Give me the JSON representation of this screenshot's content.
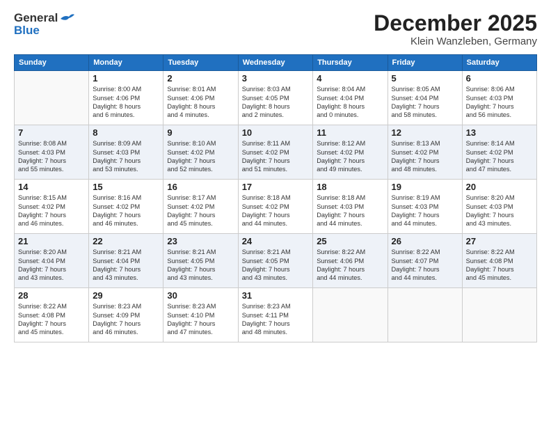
{
  "header": {
    "logo_general": "General",
    "logo_blue": "Blue",
    "title": "December 2025",
    "subtitle": "Klein Wanzleben, Germany"
  },
  "days": [
    "Sunday",
    "Monday",
    "Tuesday",
    "Wednesday",
    "Thursday",
    "Friday",
    "Saturday"
  ],
  "weeks": [
    [
      {
        "date": "",
        "info": ""
      },
      {
        "date": "1",
        "info": "Sunrise: 8:00 AM\nSunset: 4:06 PM\nDaylight: 8 hours\nand 6 minutes."
      },
      {
        "date": "2",
        "info": "Sunrise: 8:01 AM\nSunset: 4:06 PM\nDaylight: 8 hours\nand 4 minutes."
      },
      {
        "date": "3",
        "info": "Sunrise: 8:03 AM\nSunset: 4:05 PM\nDaylight: 8 hours\nand 2 minutes."
      },
      {
        "date": "4",
        "info": "Sunrise: 8:04 AM\nSunset: 4:04 PM\nDaylight: 8 hours\nand 0 minutes."
      },
      {
        "date": "5",
        "info": "Sunrise: 8:05 AM\nSunset: 4:04 PM\nDaylight: 7 hours\nand 58 minutes."
      },
      {
        "date": "6",
        "info": "Sunrise: 8:06 AM\nSunset: 4:03 PM\nDaylight: 7 hours\nand 56 minutes."
      }
    ],
    [
      {
        "date": "7",
        "info": "Sunrise: 8:08 AM\nSunset: 4:03 PM\nDaylight: 7 hours\nand 55 minutes."
      },
      {
        "date": "8",
        "info": "Sunrise: 8:09 AM\nSunset: 4:03 PM\nDaylight: 7 hours\nand 53 minutes."
      },
      {
        "date": "9",
        "info": "Sunrise: 8:10 AM\nSunset: 4:02 PM\nDaylight: 7 hours\nand 52 minutes."
      },
      {
        "date": "10",
        "info": "Sunrise: 8:11 AM\nSunset: 4:02 PM\nDaylight: 7 hours\nand 51 minutes."
      },
      {
        "date": "11",
        "info": "Sunrise: 8:12 AM\nSunset: 4:02 PM\nDaylight: 7 hours\nand 49 minutes."
      },
      {
        "date": "12",
        "info": "Sunrise: 8:13 AM\nSunset: 4:02 PM\nDaylight: 7 hours\nand 48 minutes."
      },
      {
        "date": "13",
        "info": "Sunrise: 8:14 AM\nSunset: 4:02 PM\nDaylight: 7 hours\nand 47 minutes."
      }
    ],
    [
      {
        "date": "14",
        "info": "Sunrise: 8:15 AM\nSunset: 4:02 PM\nDaylight: 7 hours\nand 46 minutes."
      },
      {
        "date": "15",
        "info": "Sunrise: 8:16 AM\nSunset: 4:02 PM\nDaylight: 7 hours\nand 46 minutes."
      },
      {
        "date": "16",
        "info": "Sunrise: 8:17 AM\nSunset: 4:02 PM\nDaylight: 7 hours\nand 45 minutes."
      },
      {
        "date": "17",
        "info": "Sunrise: 8:18 AM\nSunset: 4:02 PM\nDaylight: 7 hours\nand 44 minutes."
      },
      {
        "date": "18",
        "info": "Sunrise: 8:18 AM\nSunset: 4:03 PM\nDaylight: 7 hours\nand 44 minutes."
      },
      {
        "date": "19",
        "info": "Sunrise: 8:19 AM\nSunset: 4:03 PM\nDaylight: 7 hours\nand 44 minutes."
      },
      {
        "date": "20",
        "info": "Sunrise: 8:20 AM\nSunset: 4:03 PM\nDaylight: 7 hours\nand 43 minutes."
      }
    ],
    [
      {
        "date": "21",
        "info": "Sunrise: 8:20 AM\nSunset: 4:04 PM\nDaylight: 7 hours\nand 43 minutes."
      },
      {
        "date": "22",
        "info": "Sunrise: 8:21 AM\nSunset: 4:04 PM\nDaylight: 7 hours\nand 43 minutes."
      },
      {
        "date": "23",
        "info": "Sunrise: 8:21 AM\nSunset: 4:05 PM\nDaylight: 7 hours\nand 43 minutes."
      },
      {
        "date": "24",
        "info": "Sunrise: 8:21 AM\nSunset: 4:05 PM\nDaylight: 7 hours\nand 43 minutes."
      },
      {
        "date": "25",
        "info": "Sunrise: 8:22 AM\nSunset: 4:06 PM\nDaylight: 7 hours\nand 44 minutes."
      },
      {
        "date": "26",
        "info": "Sunrise: 8:22 AM\nSunset: 4:07 PM\nDaylight: 7 hours\nand 44 minutes."
      },
      {
        "date": "27",
        "info": "Sunrise: 8:22 AM\nSunset: 4:08 PM\nDaylight: 7 hours\nand 45 minutes."
      }
    ],
    [
      {
        "date": "28",
        "info": "Sunrise: 8:22 AM\nSunset: 4:08 PM\nDaylight: 7 hours\nand 45 minutes."
      },
      {
        "date": "29",
        "info": "Sunrise: 8:23 AM\nSunset: 4:09 PM\nDaylight: 7 hours\nand 46 minutes."
      },
      {
        "date": "30",
        "info": "Sunrise: 8:23 AM\nSunset: 4:10 PM\nDaylight: 7 hours\nand 47 minutes."
      },
      {
        "date": "31",
        "info": "Sunrise: 8:23 AM\nSunset: 4:11 PM\nDaylight: 7 hours\nand 48 minutes."
      },
      {
        "date": "",
        "info": ""
      },
      {
        "date": "",
        "info": ""
      },
      {
        "date": "",
        "info": ""
      }
    ]
  ]
}
